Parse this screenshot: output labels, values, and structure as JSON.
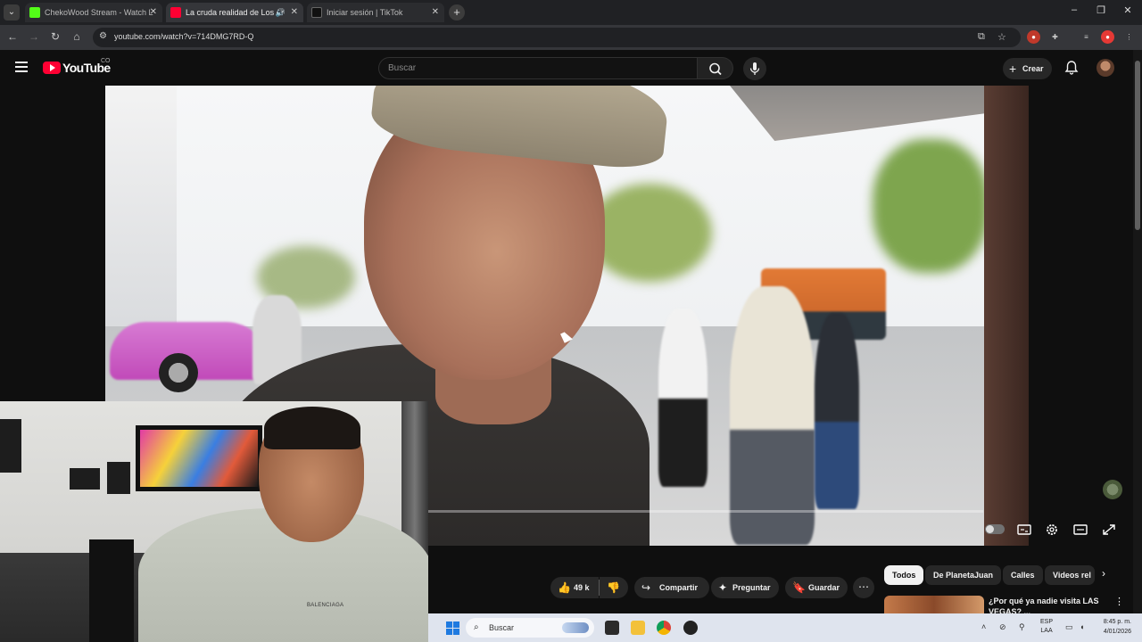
{
  "browser": {
    "tabs": [
      {
        "title": "ChekoWood Stream - Watch L",
        "favicon_color": "#53fc18"
      },
      {
        "title": "La cruda realidad de Los Ar",
        "favicon_color": "#ff0033"
      },
      {
        "title": "Iniciar sesión | TikTok",
        "favicon_color": "#111111"
      }
    ],
    "url": "youtube.com/watch?v=714DMG7RD-Q",
    "new_tab_label": "+",
    "window_controls": [
      "–",
      "❐",
      "✕"
    ]
  },
  "youtube": {
    "logo_text": "YouTube",
    "country_code": "CO",
    "search": {
      "placeholder": "Buscar",
      "value": ""
    },
    "create_label": "Crear"
  },
  "actions": {
    "like_count": "49 k",
    "share_label": "Compartir",
    "ask_label": "Preguntar",
    "save_label": "Guardar"
  },
  "chips": [
    "Todos",
    "De PlanetaJuan",
    "Calles",
    "Videos rel"
  ],
  "recommendation": {
    "title": "¿Por qué ya nadie visita LAS VEGAS? ..."
  },
  "webcam": {
    "shirt_text": "BALENCIAGA"
  },
  "taskbar": {
    "search_label": "Buscar",
    "lang_top": "ESP",
    "lang_bottom": "LAA",
    "time": "8:45 p. m.",
    "date": "4/01/2026"
  },
  "colors": {
    "accent": "#ff0033",
    "background": "#0f0f0f",
    "chip_active": "#f1f1f1"
  }
}
